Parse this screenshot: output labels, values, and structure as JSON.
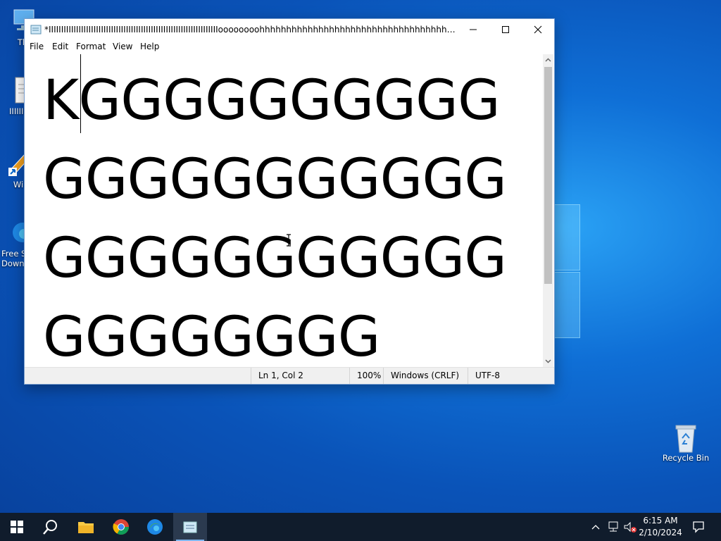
{
  "window": {
    "title": "*IIIIIIIIIIIIIIIIIIIIIIIIIIIIIIIIIIIIIIIIIIIIIIIIIIIIIIIIIIIIIIIIIIIIoooooooohhhhhhhhhhhhhhhhhhhhhhhhhhhhhhhhhhhhhhhhhhhhhhhhhhhhhh...",
    "app_icon": "notepad-icon",
    "controls": {
      "minimize": "minimize-icon",
      "maximize": "maximize-icon",
      "close": "close-icon"
    }
  },
  "menu": [
    "File",
    "Edit",
    "Format",
    "View",
    "Help"
  ],
  "editor": {
    "content": "KGGGGGGGGGGGGGGGGGGGGGGGGGGGGGGGGGGGGGGGG"
  },
  "status": {
    "position": "Ln 1, Col 2",
    "zoom": "100%",
    "line_ending": "Windows (CRLF)",
    "encoding": "UTF-8"
  },
  "desktop": {
    "icons": [
      {
        "label": "Th",
        "icon": "this-pc-icon"
      },
      {
        "label": "IIIIIIIIII",
        "icon": "text-file-icon"
      },
      {
        "label": "Wi",
        "icon": "shortcut-icon"
      },
      {
        "label": "Free S Down",
        "icon": "edge-shortcut-icon"
      },
      {
        "label": "Recycle Bin",
        "icon": "recycle-bin-icon"
      }
    ]
  },
  "taskbar": {
    "items": [
      "start-icon",
      "search-icon",
      "file-explorer-icon",
      "chrome-icon",
      "edge-icon",
      "notepad-icon"
    ],
    "tray": [
      "chevron-up-icon",
      "network-icon",
      "volume-muted-icon"
    ],
    "time": "6:15 AM",
    "date": "2/10/2024",
    "notification_icon": "notification-icon"
  },
  "colors": {
    "desktop": "#0a53b8",
    "taskbar": "#101c2c",
    "accent": "#0078d7"
  }
}
